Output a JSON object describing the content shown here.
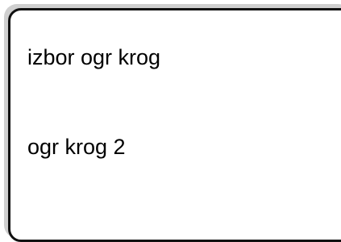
{
  "panel": {
    "items": [
      {
        "label": "izbor ogr krog"
      },
      {
        "label": "ogr krog 2"
      }
    ]
  }
}
